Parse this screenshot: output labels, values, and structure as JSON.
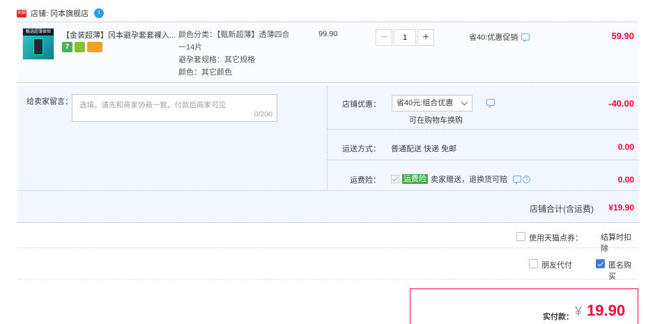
{
  "shop": {
    "badge": "天猫",
    "name": "店铺: 冈本旗舰店"
  },
  "item": {
    "thumb_text": "甄选超薄体验",
    "title": "【金装超薄】冈本避孕套套裸入...",
    "sku": [
      "颜色分类：【甄新超薄】透薄四合",
      "一14片",
      "避孕套规格：其它规格",
      "颜色：其它颜色"
    ],
    "unit_price": "99.90",
    "quantity": "1",
    "minus": "−",
    "plus": "+",
    "promo": "省40:优惠促销",
    "line_total": "59.90",
    "service_seven": "7"
  },
  "memo": {
    "label": "给卖家留言：",
    "placeholder": "选填，请先和商家协商一致，付款后商家可见",
    "count": "0/200"
  },
  "coupon": {
    "label": "店铺优惠：",
    "selected": "省40元:组合优惠",
    "note": "可在购物车换购",
    "amount": "-40.00"
  },
  "shipping": {
    "label": "运送方式：",
    "value": "普通配送 快递 免邮",
    "amount": "0.00"
  },
  "insurance": {
    "label": "运费险：",
    "tag": "运费险",
    "text": "卖家赠送，退换货可赔",
    "amount": "0.00"
  },
  "subtotal": {
    "label": "店铺合计(含运费)",
    "value": "¥19.90"
  },
  "points": {
    "label": "使用天猫点券：",
    "note": "结算时扣除"
  },
  "options": {
    "friend_pay": "朋友代付",
    "anonymous": "匿名购买",
    "anonymous_checked": true
  },
  "payment": {
    "label": "实付款：",
    "symbol": "¥",
    "amount": "19.90"
  }
}
